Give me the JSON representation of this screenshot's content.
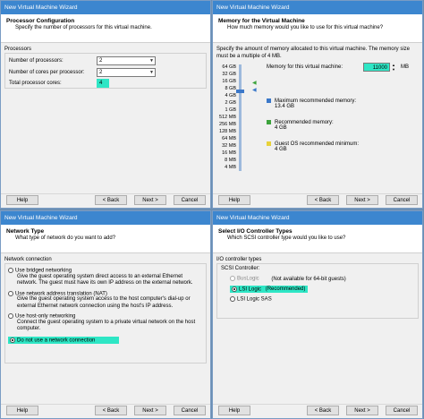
{
  "window_title": "New Virtual Machine Wizard",
  "buttons": {
    "help": "Help",
    "back": "< Back",
    "next": "Next >",
    "cancel": "Cancel"
  },
  "processor": {
    "title": "Processor Configuration",
    "subtitle": "Specify the number of processors for this virtual machine.",
    "group_label": "Processors",
    "num_processors_label": "Number of processors:",
    "num_processors_value": "2",
    "cores_label": "Number of cores per processor:",
    "cores_value": "2",
    "total_label": "Total processor cores:",
    "total_value": "4"
  },
  "memory": {
    "title": "Memory for the Virtual Machine",
    "subtitle": "How much memory would you like to use for this virtual machine?",
    "description": "Specify the amount of memory allocated to this virtual machine. The memory size must be a multiple of 4 MB.",
    "memory_label": "Memory for this virtual machine:",
    "memory_value": "11000",
    "memory_unit": "MB",
    "scale": [
      "64 GB",
      "32 GB",
      "16 GB",
      "8 GB",
      "4 GB",
      "2 GB",
      "1 GB",
      "512 MB",
      "256 MB",
      "128 MB",
      "64 MB",
      "32 MB",
      "16 MB",
      "8 MB",
      "4 MB"
    ],
    "max_rec_label": "Maximum recommended memory:",
    "max_rec_value": "13.4 GB",
    "rec_label": "Recommended memory:",
    "rec_value": "4 GB",
    "guest_min_label": "Guest OS recommended minimum:",
    "guest_min_value": "4 GB",
    "colors": {
      "max": "#3b78c9",
      "rec": "#3ca33c",
      "guest": "#e8d23a"
    }
  },
  "network": {
    "title": "Network Type",
    "subtitle": "What type of network do you want to add?",
    "group_label": "Network connection",
    "options": [
      {
        "label": "Use bridged networking",
        "desc": "Give the guest operating system direct access to an external Ethernet network. The guest must have its own IP address on the external network."
      },
      {
        "label": "Use network address translation (NAT)",
        "desc": "Give the guest operating system access to the host computer's dial-up or external Ethernet network connection using the host's IP address."
      },
      {
        "label": "Use host-only networking",
        "desc": "Connect the guest operating system to a private virtual network on the host computer."
      },
      {
        "label": "Do not use a network connection",
        "desc": ""
      }
    ]
  },
  "io": {
    "title": "Select I/O Controller Types",
    "subtitle": "Which SCSI controller type would you like to use?",
    "group_label": "I/O controller types",
    "scsi_label": "SCSI Controller:",
    "options": [
      {
        "label": "BusLogic",
        "note": "(Not available for 64-bit guests)"
      },
      {
        "label": "LSI Logic",
        "note": "(Recommended)"
      },
      {
        "label": "LSI Logic SAS",
        "note": ""
      }
    ]
  }
}
